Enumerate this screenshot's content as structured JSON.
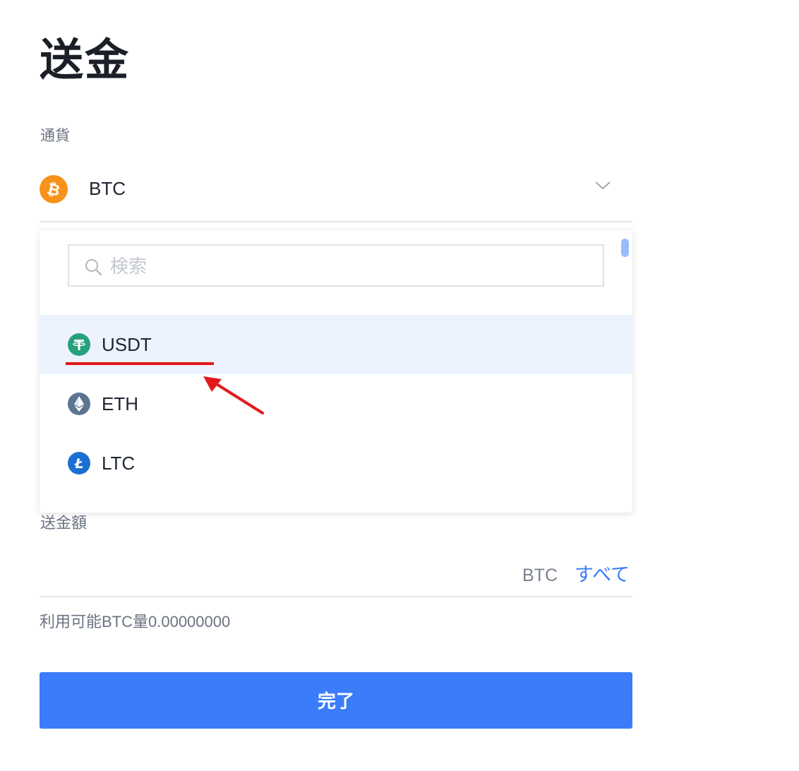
{
  "page": {
    "title": "送金"
  },
  "currency": {
    "label": "通貨",
    "selected": "BTC",
    "selected_icon": "bitcoin-icon",
    "chevron_icon": "chevron-down-icon"
  },
  "dropdown": {
    "search_placeholder": "検索",
    "search_icon": "search-icon",
    "options": [
      {
        "label": "USDT",
        "icon": "tether-icon",
        "color": "#26a17b",
        "highlighted": true
      },
      {
        "label": "ETH",
        "icon": "ethereum-icon",
        "color": "#627eea",
        "highlighted": false
      },
      {
        "label": "LTC",
        "icon": "litecoin-icon",
        "color": "#1b6fd3",
        "highlighted": false
      }
    ]
  },
  "amount": {
    "label": "送金額",
    "unit": "BTC",
    "all_link": "すべて"
  },
  "available": {
    "text": "利用可能BTC量0.00000000"
  },
  "actions": {
    "done_label": "完了"
  },
  "colors": {
    "accent": "#3b7cfa",
    "link": "#3a7bfa",
    "bitcoin": "#f7931a",
    "highlight_row": "#ecf3ff",
    "annotation": "#e31919"
  }
}
